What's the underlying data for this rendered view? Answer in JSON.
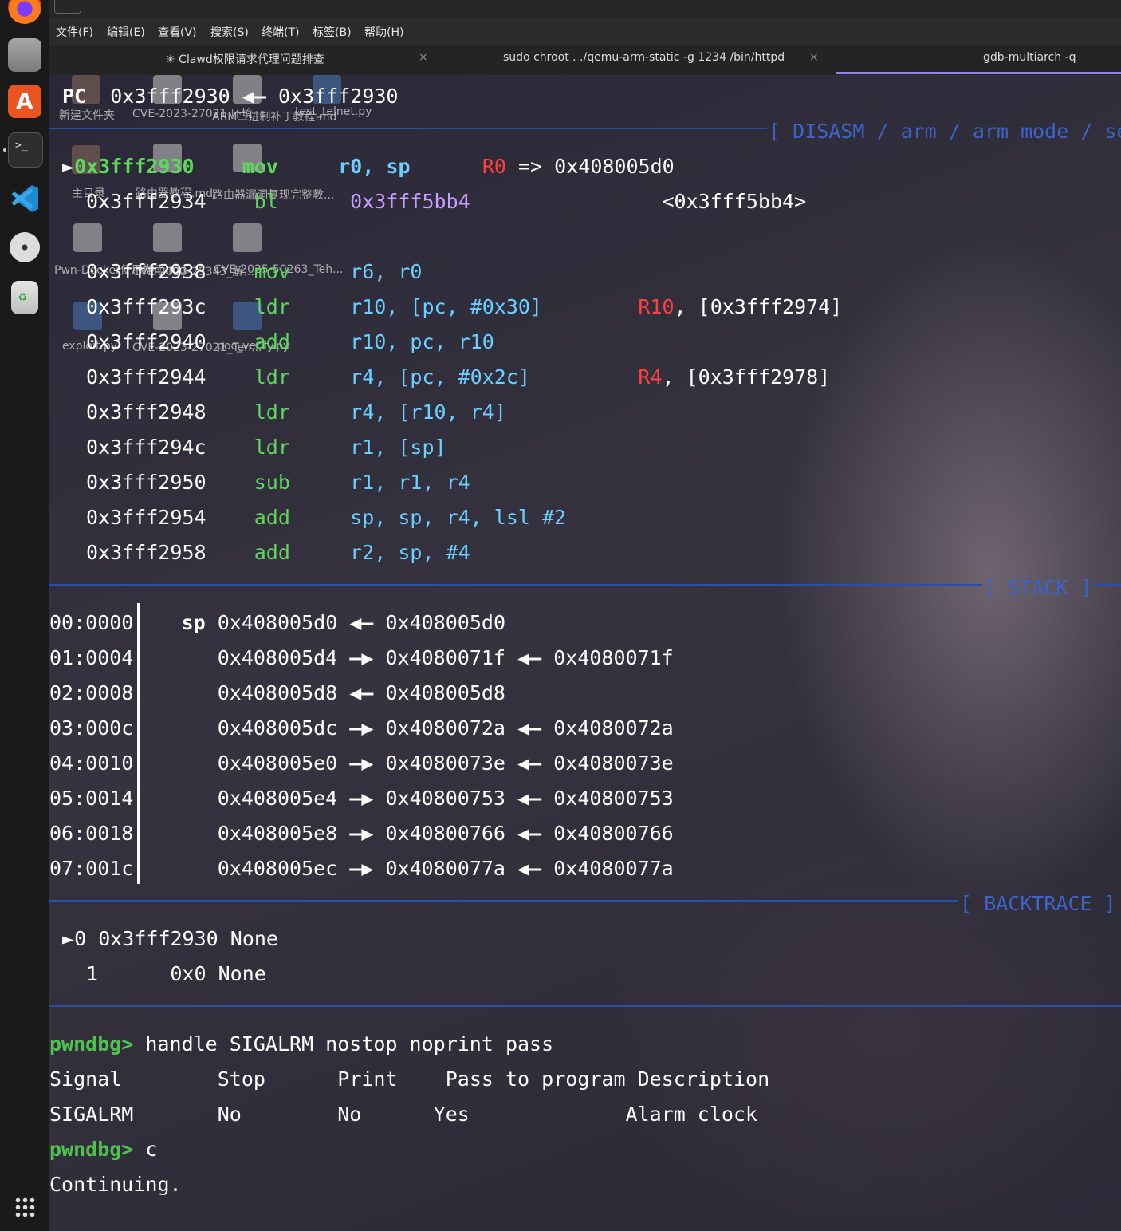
{
  "menubar": [
    "文件(F)",
    "编辑(E)",
    "查看(V)",
    "搜索(S)",
    "终端(T)",
    "标签(B)",
    "帮助(H)"
  ],
  "tabs": [
    {
      "label": "✳ Clawd权限请求代理问题排查",
      "close": "×"
    },
    {
      "label": "sudo chroot . ./qemu-arm-static -g 1234 /bin/httpd",
      "close": "×"
    },
    {
      "label": "gdb-multiarch -q"
    }
  ],
  "dock": [
    "firefox-icon",
    "files-icon",
    "app-center-icon",
    "terminal-icon",
    "vscode-icon",
    "disc-icon",
    "trash-icon",
    "apps-grid-icon"
  ],
  "desktop_items": [
    "新建文件夹",
    "CVE-2023-27021 环境...",
    "ARM二进制补丁教程.md",
    "test_telnet.py",
    "主目录",
    "路由器教程.md",
    "路由器漏洞复现完整教...",
    "Pwn-Docker使用指南.md",
    "CVE-2023-25343_解...",
    "CVE-2025-50263_Teh...",
    "exploit.py",
    "CVE-2023-27021_Ten...",
    "poc_verify.py"
  ],
  "pc_line": {
    "label": "PC",
    "addr": "0x3fff2930",
    "arrow": "◀—",
    "target": "0x3fff2930"
  },
  "disasm_header": "[ DISASM / arm / arm mode / se",
  "disasm": [
    {
      "marker": "►",
      "addr": "0x3fff2930",
      "op": "mov",
      "args": "r0, sp",
      "reg": "R0",
      "note": "=> 0x408005d0"
    },
    {
      "addr": "0x3fff2934",
      "op": "bl",
      "args": "0x3fff5bb4",
      "note": "<0x3fff5bb4>"
    },
    {
      "addr": "0x3fff2938",
      "op": "mov",
      "args": "r6, r0"
    },
    {
      "addr": "0x3fff293c",
      "op": "ldr",
      "args": "r10, [pc, #0x30]",
      "reg": "R10",
      "note": ", [0x3fff2974]"
    },
    {
      "addr": "0x3fff2940",
      "op": "add",
      "args": "r10, pc, r10"
    },
    {
      "addr": "0x3fff2944",
      "op": "ldr",
      "args": "r4, [pc, #0x2c]",
      "reg": "R4",
      "note": ", [0x3fff2978]"
    },
    {
      "addr": "0x3fff2948",
      "op": "ldr",
      "args": "r4, [r10, r4]"
    },
    {
      "addr": "0x3fff294c",
      "op": "ldr",
      "args": "r1, [sp]"
    },
    {
      "addr": "0x3fff2950",
      "op": "sub",
      "args": "r1, r1, r4"
    },
    {
      "addr": "0x3fff2954",
      "op": "add",
      "args": "sp, sp, r4, lsl #2"
    },
    {
      "addr": "0x3fff2958",
      "op": "add",
      "args": "r2, sp, #4"
    }
  ],
  "stack_header": "[ STACK ]",
  "stack": [
    {
      "off": "00:0000",
      "reg": "sp",
      "a": "0x408005d0",
      "arr1": "◀—",
      "b": "0x408005d0"
    },
    {
      "off": "01:0004",
      "a": "0x408005d4",
      "arr1": "—▶",
      "b": "0x4080071f",
      "arr2": "◀—",
      "c": "0x4080071f"
    },
    {
      "off": "02:0008",
      "a": "0x408005d8",
      "arr1": "◀—",
      "b": "0x408005d8"
    },
    {
      "off": "03:000c",
      "a": "0x408005dc",
      "arr1": "—▶",
      "b": "0x4080072a",
      "arr2": "◀—",
      "c": "0x4080072a"
    },
    {
      "off": "04:0010",
      "a": "0x408005e0",
      "arr1": "—▶",
      "b": "0x4080073e",
      "arr2": "◀—",
      "c": "0x4080073e"
    },
    {
      "off": "05:0014",
      "a": "0x408005e4",
      "arr1": "—▶",
      "b": "0x40800753",
      "arr2": "◀—",
      "c": "0x40800753"
    },
    {
      "off": "06:0018",
      "a": "0x408005e8",
      "arr1": "—▶",
      "b": "0x40800766",
      "arr2": "◀—",
      "c": "0x40800766"
    },
    {
      "off": "07:001c",
      "a": "0x408005ec",
      "arr1": "—▶",
      "b": "0x4080077a",
      "arr2": "◀—",
      "c": "0x4080077a"
    }
  ],
  "backtrace_header": "[ BACKTRACE ]",
  "backtrace": [
    {
      "marker": "►",
      "idx": "0",
      "addr": "0x3fff2930",
      "name": "None"
    },
    {
      "idx": "1",
      "addr": "0x0",
      "name": "None"
    }
  ],
  "console": {
    "prompt": "pwndbg>",
    "cmd1": " handle SIGALRM nostop noprint pass",
    "table_header": [
      "Signal",
      "Stop",
      "Print",
      "Pass to program",
      "Description"
    ],
    "table_row": [
      "SIGALRM",
      "No",
      "No",
      "Yes",
      "Alarm clock"
    ],
    "cmd2": " c",
    "output": "Continuing."
  },
  "colors": {
    "green": "#5fd75f",
    "cyan": "#6ad0ff",
    "purple": "#c99cff",
    "red": "#ff4040",
    "section_line": "#2a4fa8"
  }
}
